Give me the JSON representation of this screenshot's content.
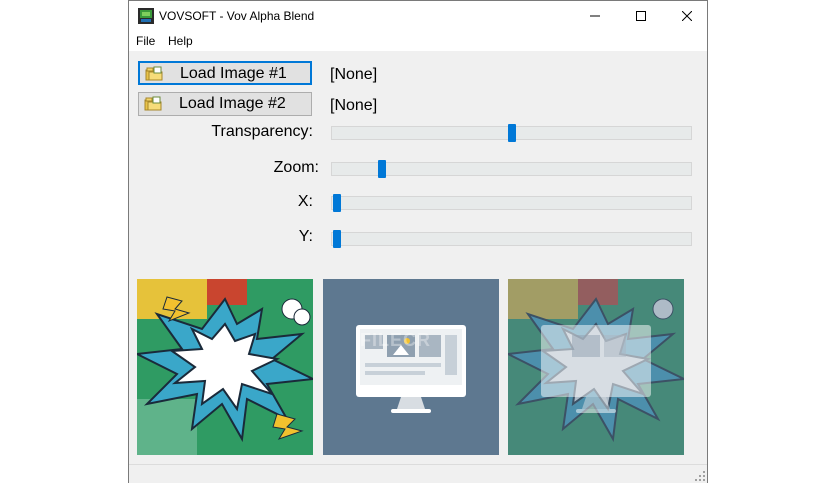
{
  "window": {
    "title": "VOVSOFT - Vov Alpha Blend",
    "minimize_icon": "minimize-icon",
    "maximize_icon": "maximize-icon",
    "close_icon": "close-icon"
  },
  "menu": {
    "file": "File",
    "help": "Help"
  },
  "controls": {
    "load1_label": "Load Image #1",
    "load2_label": "Load Image #2",
    "image1_path": "[None]",
    "image2_path": "[None]",
    "transparency_label": "Transparency:",
    "zoom_label": "Zoom:",
    "x_label": "X:",
    "y_label": "Y:",
    "transparency_value": 0.5,
    "zoom_value": 0.13,
    "x_value": 0.0,
    "y_value": 0.0
  },
  "watermark": "FILECR",
  "colors": {
    "accent": "#0078d7",
    "panel_bg": "#5e7890"
  }
}
